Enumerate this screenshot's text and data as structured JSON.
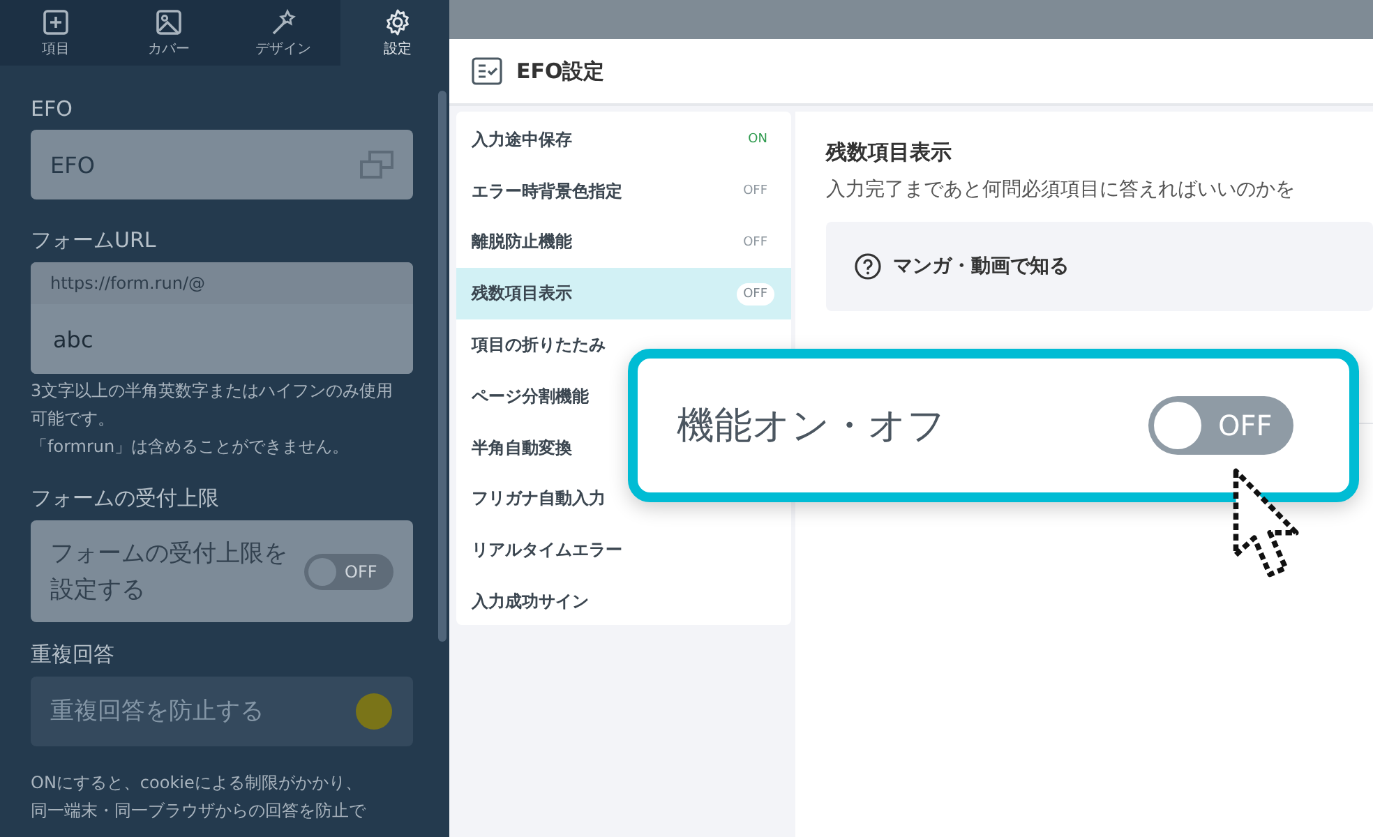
{
  "sidebar": {
    "tabs": [
      {
        "label": "項目",
        "selected": false
      },
      {
        "label": "カバー",
        "selected": false
      },
      {
        "label": "デザイン",
        "selected": false
      },
      {
        "label": "設定",
        "selected": true
      }
    ],
    "sections": [
      {
        "kind": "field",
        "label": "EFO",
        "value": "EFO"
      },
      {
        "kind": "url",
        "label": "フォームURL",
        "prefix": "https://form.run/@",
        "value": "abc",
        "help": [
          "3文字以上の半角英数字またはハイフンのみ使用可能です。",
          "「formrun」は含めることができません。"
        ]
      },
      {
        "kind": "toggle",
        "label": "フォームの受付上限",
        "text": "フォームの受付上限を設定する",
        "toggle": "OFF",
        "on": false,
        "disabled": false
      },
      {
        "kind": "toggle",
        "label": "重複回答",
        "text": "重複回答を防止する",
        "disabled": true,
        "help": [
          "ONにすると、cookieによる制限がかかり、",
          "同一端末・同一ブラウザからの回答を防止で"
        ]
      }
    ]
  },
  "modal": {
    "title": "EFO設定",
    "items": [
      {
        "label": "入力途中保存",
        "status": "ON",
        "on": true,
        "selected": false
      },
      {
        "label": "エラー時背景色指定",
        "status": "OFF",
        "on": false,
        "selected": false
      },
      {
        "label": "離脱防止機能",
        "status": "OFF",
        "on": false,
        "selected": false
      },
      {
        "label": "残数項目表示",
        "status": "OFF",
        "on": false,
        "selected": true
      },
      {
        "label": "項目の折りたたみ",
        "selected": false
      },
      {
        "label": "ページ分割機能",
        "selected": false
      },
      {
        "label": "半角自動変換",
        "selected": false
      },
      {
        "label": "フリガナ自動入力",
        "selected": false
      },
      {
        "label": "リアルタイムエラー",
        "selected": false
      },
      {
        "label": "入力成功サイン",
        "selected": false
      }
    ],
    "detail": {
      "title": "残数項目表示",
      "description": "入力完了まであと何問必須項目に答えればいいのかを",
      "help_link": "マンガ・動画で知る"
    }
  },
  "callout": {
    "label": "機能オン・オフ",
    "toggle": "OFF",
    "on": false
  }
}
